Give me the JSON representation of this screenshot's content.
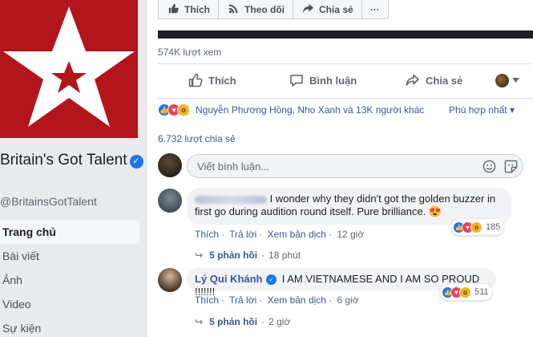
{
  "page": {
    "name": "Britain's Got Talent",
    "handle": "@BritainsGotTalent",
    "nav": [
      "Trang chủ",
      "Bài viết",
      "Ảnh",
      "Video",
      "Sự kiện"
    ]
  },
  "top_buttons": [
    {
      "label": "Thích",
      "icon": "like-icon"
    },
    {
      "label": "Theo dõi",
      "icon": "rss-icon"
    },
    {
      "label": "Chia sẻ",
      "icon": "share-icon"
    },
    {
      "label": "···",
      "icon": "more-icon"
    }
  ],
  "post": {
    "views": "574K lượt xem",
    "actions": {
      "like": "Thích",
      "comment": "Bình luận",
      "share": "Chia sẻ"
    },
    "reactions_text": "Nguyễn Phương Hồng, Nho Xanh và 13K người khác",
    "sort_label": "Phù hợp nhất ▾",
    "shares": "6.732 lượt chia sẻ",
    "compose_placeholder": "Viết bình luận..."
  },
  "comments": [
    {
      "author": "",
      "text": "I wonder why they didn't got the golden buzzer in first go during audition round itself. Pure brilliance. 😍",
      "meta": {
        "like": "Thích",
        "reply": "Trả lời",
        "translate": "Xem bản dịch",
        "time": "12 giờ"
      },
      "reactions_count": "185",
      "replies": "5 phản hồi",
      "replies_time": "18 phút"
    },
    {
      "author": "Lý Qui Khánh",
      "text": "I AM VIETNAMESE AND I AM SO PROUD !!!!!!!",
      "meta": {
        "like": "Thích",
        "reply": "Trả lời",
        "translate": "Xem bản dịch",
        "time": "6 giờ"
      },
      "reactions_count": "511",
      "replies": "5 phản hồi",
      "replies_time": "2 giờ"
    }
  ],
  "colors": {
    "brand_red": "#b2151b",
    "link_blue": "#385898",
    "fb_blue": "#1877f2"
  }
}
